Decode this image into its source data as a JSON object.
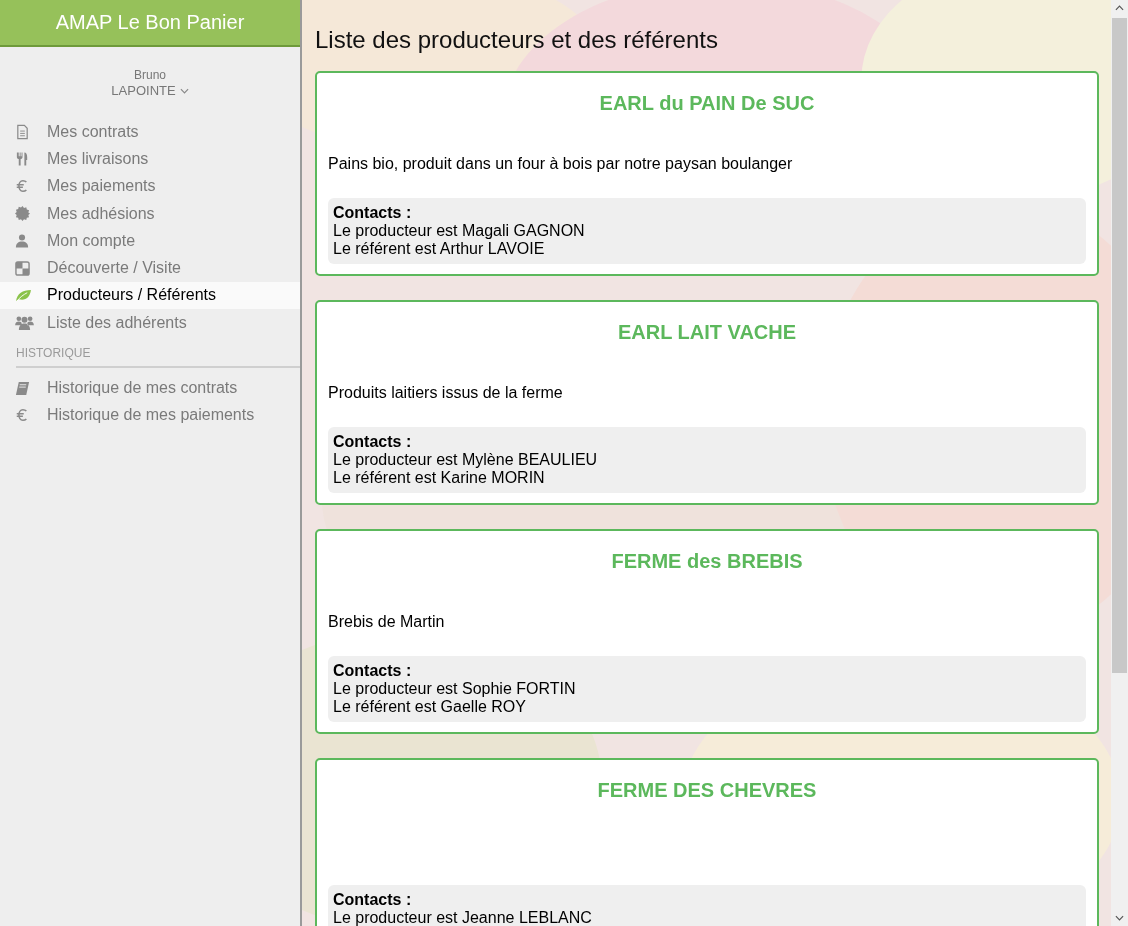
{
  "app_title": "AMAP Le Bon Panier",
  "user": {
    "first_name": "Bruno",
    "last_name": "LAPOINTE"
  },
  "nav_items": [
    {
      "label": "Mes contrats",
      "selected": false
    },
    {
      "label": "Mes livraisons",
      "selected": false
    },
    {
      "label": "Mes paiements",
      "selected": false
    },
    {
      "label": "Mes adhésions",
      "selected": false
    },
    {
      "label": "Mon compte",
      "selected": false
    },
    {
      "label": "Découverte / Visite",
      "selected": false
    },
    {
      "label": "Producteurs / Référents",
      "selected": true
    },
    {
      "label": "Liste des adhérents",
      "selected": false
    }
  ],
  "history_section": {
    "heading": "HISTORIQUE",
    "items": [
      {
        "label": "Historique de mes contrats",
        "selected": false
      },
      {
        "label": "Historique de mes paiements",
        "selected": false
      }
    ]
  },
  "page_title": "Liste des producteurs et des référents",
  "producers": [
    {
      "name": "EARL du PAIN De SUC",
      "description": "Pains bio, produit dans un four à bois par notre paysan boulanger",
      "contacts_label": "Contacts :",
      "contacts": [
        "Le producteur est Magali GAGNON",
        "Le référent est Arthur LAVOIE"
      ]
    },
    {
      "name": "EARL LAIT VACHE",
      "description": "Produits laitiers issus de la ferme",
      "contacts_label": "Contacts :",
      "contacts": [
        "Le producteur est Mylène BEAULIEU",
        "Le référent est Karine MORIN"
      ]
    },
    {
      "name": "FERME des BREBIS",
      "description": "Brebis de Martin",
      "contacts_label": "Contacts :",
      "contacts": [
        "Le producteur est Sophie FORTIN",
        "Le référent est Gaelle ROY"
      ]
    },
    {
      "name": "FERME DES CHEVRES",
      "contacts_label": "Contacts :",
      "contacts": [
        "Le producteur est Jeanne LEBLANC"
      ]
    }
  ]
}
